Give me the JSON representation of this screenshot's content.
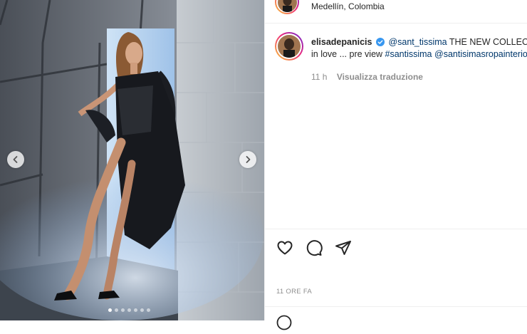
{
  "post": {
    "location": "Medellín, Colombia",
    "username": "elisadepanicis",
    "caption_mention": "@sant_tissima",
    "caption_text_1": " THE NEW COLLECTION",
    "caption_text_2": "in love ... pre view ",
    "caption_hashtag": "#santissima",
    "caption_mention_2": "@santisimasropainterior",
    "caption_time": "11 h",
    "translate_label": "Visualizza traduzione",
    "time_ago": "11 ORE FA"
  },
  "carousel": {
    "total_slides": 7,
    "active_slide": 1
  },
  "icons": {
    "like": "heart-icon",
    "comment": "comment-icon",
    "share": "paper-plane-icon",
    "prev": "chevron-left-icon",
    "next": "chevron-right-icon",
    "verified": "verified-badge-icon",
    "emoji": "emoji-icon"
  },
  "colors": {
    "link": "#00376b",
    "verified": "#3897f0",
    "muted": "#8e8e8e",
    "text": "#262626"
  }
}
